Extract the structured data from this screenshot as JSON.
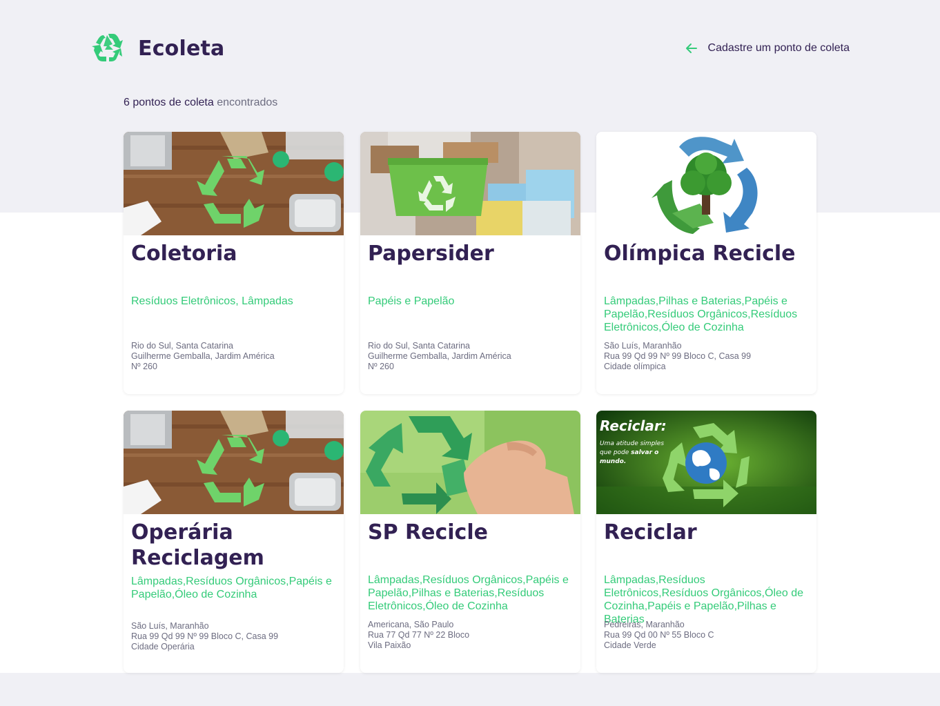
{
  "brand": {
    "name": "Ecoleta",
    "icon": "recycle-icon",
    "accent": "#34cb79"
  },
  "header": {
    "back_label": "Cadastre um ponto de coleta",
    "back_icon": "arrow-left-icon"
  },
  "results": {
    "count_strong": "6 pontos de coleta",
    "count_rest": " encontrados"
  },
  "colors": {
    "title": "#322153",
    "accent": "#34cb79",
    "muted": "#6c6c80",
    "background": "#f0f0f5"
  },
  "points": [
    {
      "name": "Coletoria",
      "items": "Resíduos Eletrônicos, Lâmpadas",
      "address": [
        "Rio do Sul, Santa Catarina",
        "Guilherme Gemballa, Jardim América",
        "Nº 260"
      ]
    },
    {
      "name": "Papersider",
      "items": "Papéis e Papelão",
      "address": [
        "Rio do Sul, Santa Catarina",
        "Guilherme Gemballa, Jardim América",
        "Nº 260"
      ]
    },
    {
      "name": "Olímpica Recicle",
      "items": "Lâmpadas,Pilhas e Baterias,Papéis e Papelão,Resíduos Orgânicos,Resíduos Eletrônicos,Óleo de Cozinha",
      "address": [
        "São Luís, Maranhão",
        "Rua 99 Qd 99 Nº 99 Bloco C, Casa 99",
        "Cidade olímpica"
      ]
    },
    {
      "name": "Operária Reciclagem",
      "items": "Lâmpadas,Resíduos Orgânicos,Papéis e Papelão,Óleo de Cozinha",
      "address": [
        "São Luís, Maranhão",
        "Rua 99 Qd 99 Nº 99 Bloco C, Casa 99",
        "Cidade Operária"
      ]
    },
    {
      "name": "SP Recicle",
      "items": "Lâmpadas,Resíduos Orgânicos,Papéis e Papelão,Pilhas e Baterias,Resíduos Eletrônicos,Óleo de Cozinha",
      "address": [
        "Americana, São Paulo",
        "Rua 77 Qd 77 Nº 22 Bloco",
        "Vila Paixão"
      ]
    },
    {
      "name": "Reciclar",
      "items": "Lâmpadas,Resíduos Eletrônicos,Resíduos Orgânicos,Óleo de Cozinha,Papéis e Papelão,Pilhas e Baterias",
      "address": [
        "Pedreiras, Maranhão",
        "Rua 99 Qd 00 Nº 55 Bloco C",
        "Cidade Verde"
      ],
      "image_text": {
        "headline": "Reciclar:",
        "line1": "Uma atitude simples",
        "line2_a": "que pode ",
        "line2_b": "salvar o",
        "line3": "mundo."
      }
    }
  ]
}
